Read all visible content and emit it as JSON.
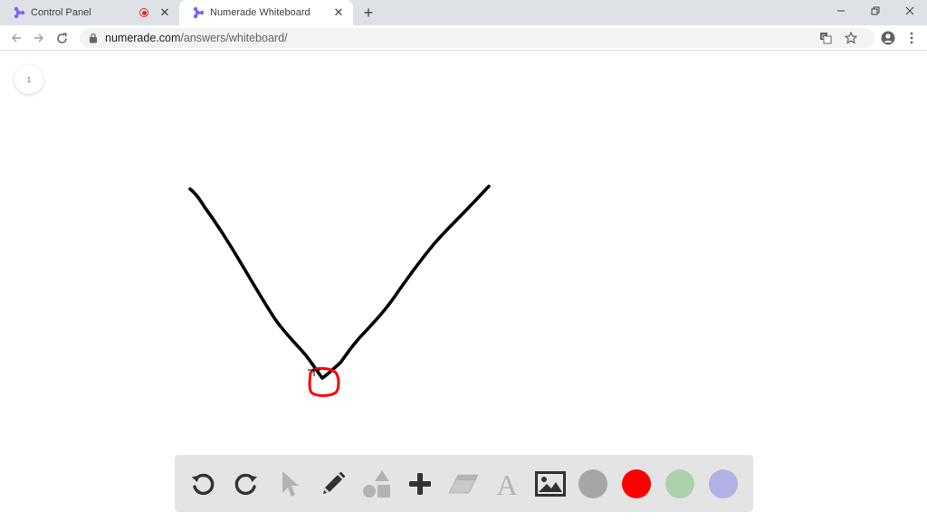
{
  "browser": {
    "tabs": [
      {
        "title": "Control Panel",
        "recording": true,
        "active": false
      },
      {
        "title": "Numerade Whiteboard",
        "active": true
      }
    ],
    "url_host": "numerade.com",
    "url_path": "/answers/whiteboard/",
    "window_controls": [
      "minimize",
      "restore",
      "close"
    ]
  },
  "whiteboard": {
    "page_number": "1",
    "stroke_color": "#000000",
    "highlight_color": "#ff0000"
  },
  "toolbar": {
    "tools": [
      {
        "name": "undo-icon",
        "interactable": true
      },
      {
        "name": "redo-icon",
        "interactable": true
      },
      {
        "name": "pointer-icon",
        "interactable": true
      },
      {
        "name": "pen-icon",
        "interactable": true
      },
      {
        "name": "shapes-icon",
        "interactable": true
      },
      {
        "name": "plus-icon",
        "interactable": true
      },
      {
        "name": "eraser-icon",
        "interactable": true
      },
      {
        "name": "text-icon",
        "interactable": true
      },
      {
        "name": "image-icon",
        "interactable": true
      }
    ],
    "colors": [
      "#a6a6a6",
      "#ff0000",
      "#acd1ac",
      "#b1b1e6"
    ]
  }
}
